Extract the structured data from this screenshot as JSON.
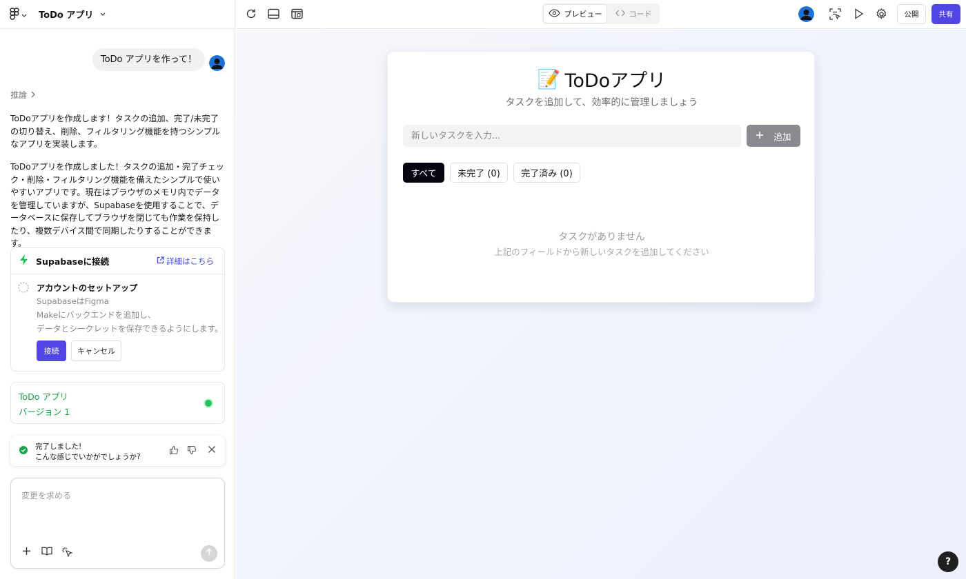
{
  "header": {
    "app_title": "ToDo アプリ"
  },
  "chat": {
    "user_message": "ToDo アプリを作って！",
    "reasoning_label": "推論",
    "paragraph_1": "ToDoアプリを作成します！タスクの追加、完了/未完了の切り替え、削除、フィルタリング機能を持つシンプルなアプリを実装します。",
    "paragraph_2": "ToDoアプリを作成しました！タスクの追加・完了チェック・削除・フィルタリング機能を備えたシンプルで使いやすいアプリです。現在はブラウザのメモリ内でデータを管理していますが、Supabaseを使用することで、データベースに保存してブラウザを閉じても作業を保持したり、複数デバイス間で同期したりすることができます。"
  },
  "supabase": {
    "title": "Supabaseに接続",
    "link": "詳細はこちら",
    "setup_title": "アカウントのセットアップ",
    "desc_1": "SupabaseはFigma",
    "desc_2": "Makeにバックエンドを追加し、",
    "desc_3": "データとシークレットを保存できるようにします。",
    "connect": "接続",
    "cancel": "キャンセル"
  },
  "version": {
    "name": "ToDo アプリ",
    "number": "バージョン 1"
  },
  "toast": {
    "line_1": "完了しました!",
    "line_2": "こんな感じでいかがでしょうか?"
  },
  "composer": {
    "placeholder": "変更を求める"
  },
  "topbar": {
    "preview": "プレビュー",
    "code": "コード",
    "publish": "公開",
    "share": "共有"
  },
  "todo": {
    "emoji": "📝",
    "title": "ToDoアプリ",
    "subtitle": "タスクを追加して、効率的に管理しましょう",
    "input_placeholder": "新しいタスクを入力...",
    "add_label": "追加",
    "filters": [
      "すべて",
      "未完了 (0)",
      "完了済み (0)"
    ],
    "empty_title": "タスクがありません",
    "empty_hint": "上記のフィールドから新しいタスクを追加してください"
  },
  "help": "?",
  "colors": {
    "accent": "#4f46e5",
    "success": "#16a34a",
    "supabase_green": "#22c55e"
  }
}
